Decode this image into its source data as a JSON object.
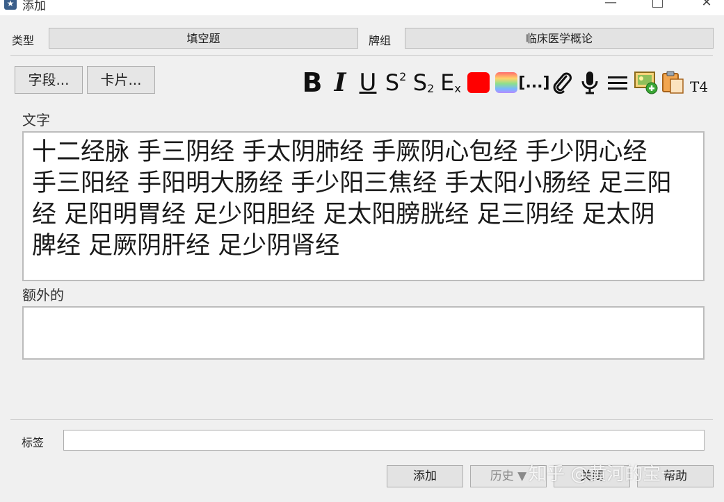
{
  "window": {
    "title": "添加"
  },
  "header": {
    "type_label": "类型",
    "type_value": "填空题",
    "deck_label": "牌组",
    "deck_value": "临床医学概论"
  },
  "toolbar": {
    "fields_button": "字段...",
    "cards_button": "卡片...",
    "bold": "B",
    "italic": "I",
    "underline": "U",
    "superscript_main": "S",
    "superscript_mark": "2",
    "subscript_main": "S",
    "subscript_mark": "2",
    "clear_format_main": "E",
    "clear_format_mark": "x",
    "cloze": "[...]",
    "t4": "T4",
    "text_color": "#ff0000"
  },
  "fields": [
    {
      "label": "文字",
      "value": "十二经脉 手三阴经 手太阴肺经 手厥阴心包经 手少阴心经 手三阳经 手阳明大肠经 手少阳三焦经 手太阳小肠经 足三阳经 足阳明胃经 足少阳胆经 足太阳膀胱经 足三阴经 足太阴脾经 足厥阴肝经 足少阴肾经"
    },
    {
      "label": "额外的",
      "value": ""
    }
  ],
  "tags": {
    "label": "标签",
    "value": ""
  },
  "footer": {
    "add": "添加",
    "history": "历史 ▼",
    "close": "关闭",
    "help": "帮助"
  },
  "watermark": "知乎 @黄河的宝一"
}
